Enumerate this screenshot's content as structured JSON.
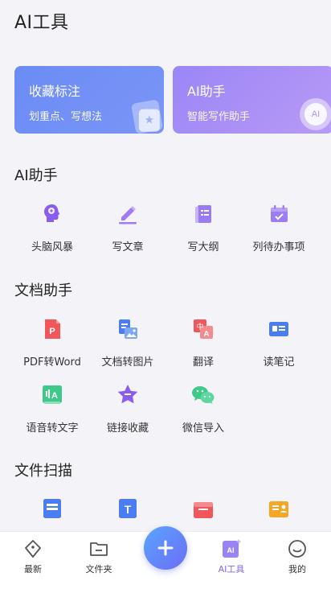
{
  "page_title": "AI工具",
  "cards": [
    {
      "title": "收藏标注",
      "subtitle": "划重点、写想法",
      "deco": "star-icon"
    },
    {
      "title": "AI助手",
      "subtitle": "智能写作助手",
      "deco": "ai-badge-icon",
      "badge": "AI"
    }
  ],
  "sections": {
    "ai_assistant": {
      "title": "AI助手",
      "items": [
        {
          "label": "头脑风暴",
          "icon": "brain-icon"
        },
        {
          "label": "写文章",
          "icon": "pencil-icon"
        },
        {
          "label": "写大纲",
          "icon": "outline-icon"
        },
        {
          "label": "列待办事项",
          "icon": "calendar-check-icon"
        }
      ]
    },
    "doc_assistant": {
      "title": "文档助手",
      "items": [
        {
          "label": "PDF转Word",
          "icon": "pdf-icon",
          "glyph": "P"
        },
        {
          "label": "文档转图片",
          "icon": "doc-image-icon"
        },
        {
          "label": "翻译",
          "icon": "translate-icon",
          "glyph_a": "中",
          "glyph_b": "A"
        },
        {
          "label": "读笔记",
          "icon": "note-card-icon"
        },
        {
          "label": "语音转文字",
          "icon": "voice-text-icon",
          "glyph": "A"
        },
        {
          "label": "链接收藏",
          "icon": "link-star-icon"
        },
        {
          "label": "微信导入",
          "icon": "wechat-icon"
        }
      ]
    },
    "file_scan": {
      "title": "文件扫描",
      "items": [
        {
          "label": "",
          "icon": "scan-doc-icon"
        },
        {
          "label": "",
          "icon": "text-scan-icon",
          "glyph": "T"
        },
        {
          "label": "",
          "icon": "scan-folder-icon"
        },
        {
          "label": "",
          "icon": "id-card-icon"
        }
      ]
    }
  },
  "bottom_nav": {
    "items": [
      {
        "label": "最新",
        "icon": "tag-icon"
      },
      {
        "label": "文件夹",
        "icon": "folder-icon"
      },
      {
        "label": "AI工具",
        "icon": "ai-tools-icon",
        "active": true,
        "badge": "AI"
      },
      {
        "label": "我的",
        "icon": "smile-icon"
      }
    ],
    "fab_icon": "plus-icon"
  },
  "colors": {
    "accent": "#7b6cf0",
    "card1": "#6b8cf5",
    "card2": "#a88ff7",
    "fab": "#5a8cf8"
  }
}
